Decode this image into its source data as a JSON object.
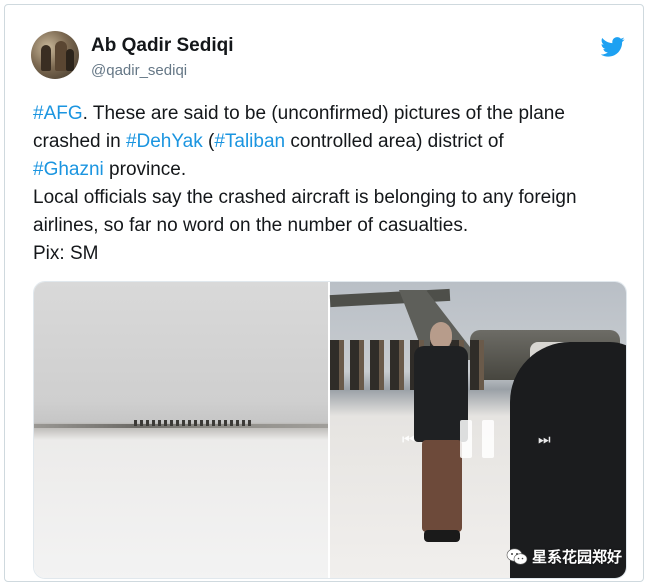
{
  "author": {
    "display_name": "Ab Qadir Sediqi",
    "handle": "@qadir_sediqi"
  },
  "brand_icon": "twitter-bird-icon",
  "colors": {
    "hashtag": "#1b95e0",
    "text": "#14171a",
    "muted": "#657786",
    "twitter_blue": "#1da1f2"
  },
  "tweet": {
    "line1": {
      "tag_afg": "#AFG",
      "text": ". These are said to be (unconfirmed) pictures of the plane"
    },
    "line2": {
      "pre": "crashed in ",
      "tag_dehyak": "#DehYak",
      "mid": " (",
      "tag_taliban": "#Taliban",
      "post": " controlled area) district of"
    },
    "line3": {
      "tag_ghazni": "#Ghazni",
      "post": " province."
    },
    "line4": "Local officials say the crashed aircraft is belonging to any foreign",
    "line5": "airlines, so far no word on the number of casualties.",
    "line6": "Pix: SM"
  },
  "media": {
    "video_controls": {
      "rewind": "⏮",
      "pause": "pause-icon",
      "forward": "⏭"
    }
  },
  "watermark": {
    "text": "星系花园郑好",
    "icon": "wechat-icon"
  }
}
